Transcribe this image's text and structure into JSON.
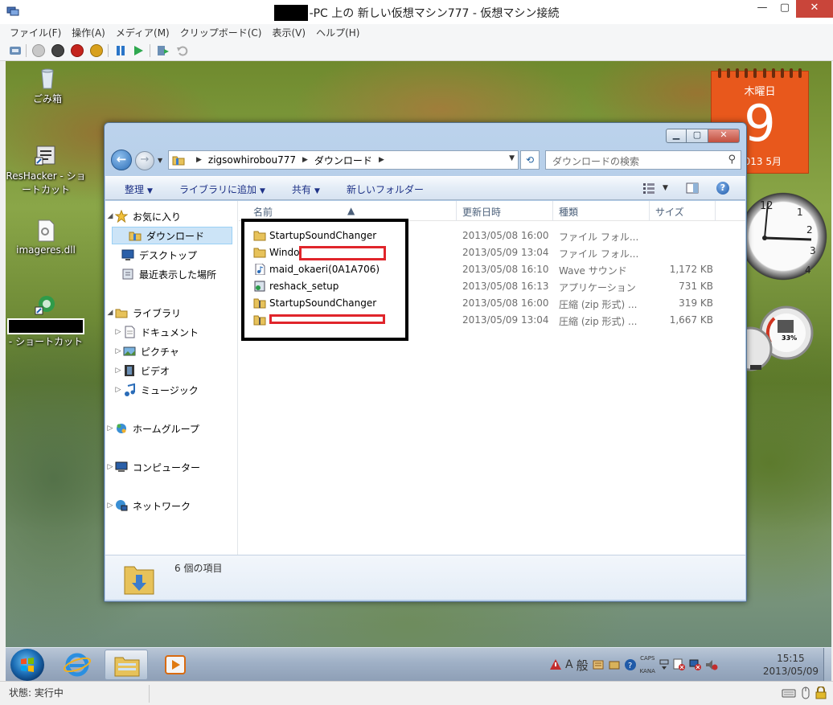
{
  "window": {
    "title_prefix": "-PC 上の 新しい仮想マシン777",
    "title_suffix": " - 仮想マシン接続",
    "close_label": "✕",
    "min_label": "—",
    "max_label": "▢"
  },
  "menubar": {
    "items": [
      "ファイル(F)",
      "操作(A)",
      "メディア(M)",
      "クリップボード(C)",
      "表示(V)",
      "ヘルプ(H)"
    ]
  },
  "desktop": {
    "icons": [
      {
        "label": "ごみ箱"
      },
      {
        "label": "ResHacker - ショートカット"
      },
      {
        "label": "imageres.dll"
      },
      {
        "label": "- ショートカット"
      }
    ],
    "calendar": {
      "weekday": "木曜日",
      "day": "9",
      "year_month": "2013 5月"
    },
    "meter_pct": "33%"
  },
  "explorer": {
    "breadcrumb": [
      "zigsowhirobou777",
      "ダウンロード"
    ],
    "search_placeholder": "ダウンロードの検索",
    "commands": {
      "organize": "整理",
      "add_to_library": "ライブラリに追加",
      "share": "共有",
      "new_folder": "新しいフォルダー"
    },
    "nav": {
      "favorites": "お気に入り",
      "downloads": "ダウンロード",
      "desktop": "デスクトップ",
      "recent": "最近表示した場所",
      "libraries": "ライブラリ",
      "documents": "ドキュメント",
      "pictures": "ピクチャ",
      "videos": "ビデオ",
      "music": "ミュージック",
      "homegroup": "ホームグループ",
      "computer": "コンピューター",
      "network": "ネットワーク"
    },
    "columns": {
      "name": "名前",
      "date": "更新日時",
      "type": "種類",
      "size": "サイズ"
    },
    "files": [
      {
        "name": "StartupSoundChanger",
        "date": "2013/05/08 16:00",
        "type": "ファイル フォル...",
        "size": "",
        "icon": "folder-icon"
      },
      {
        "name": "Windo",
        "date": "2013/05/09 13:04",
        "type": "ファイル フォル...",
        "size": "",
        "icon": "folder-icon"
      },
      {
        "name": "maid_okaeri(0A1A706)",
        "date": "2013/05/08 16:10",
        "type": "Wave サウンド",
        "size": "1,172 KB",
        "icon": "audio-file-icon"
      },
      {
        "name": "reshack_setup",
        "date": "2013/05/08 16:13",
        "type": "アプリケーション",
        "size": "731 KB",
        "icon": "installer-icon"
      },
      {
        "name": "StartupSoundChanger",
        "date": "2013/05/08 16:00",
        "type": "圧縮 (zip 形式) ...",
        "size": "319 KB",
        "icon": "zip-folder-icon"
      },
      {
        "name": "",
        "date": "2013/05/09 13:04",
        "type": "圧縮 (zip 形式) ...",
        "size": "1,667 KB",
        "icon": "zip-folder-icon"
      }
    ],
    "item_count": "6 個の項目"
  },
  "taskbar": {
    "time": "15:15",
    "date": "2013/05/09",
    "ime_mode": "A",
    "ime_kanji": "般",
    "caps": "CAPS",
    "kana": "KANA"
  },
  "status": {
    "text": "状態: 実行中"
  },
  "colors": {
    "accent": "#e8581c",
    "selection": "#cce4f7",
    "redact_red": "#e0252b"
  }
}
